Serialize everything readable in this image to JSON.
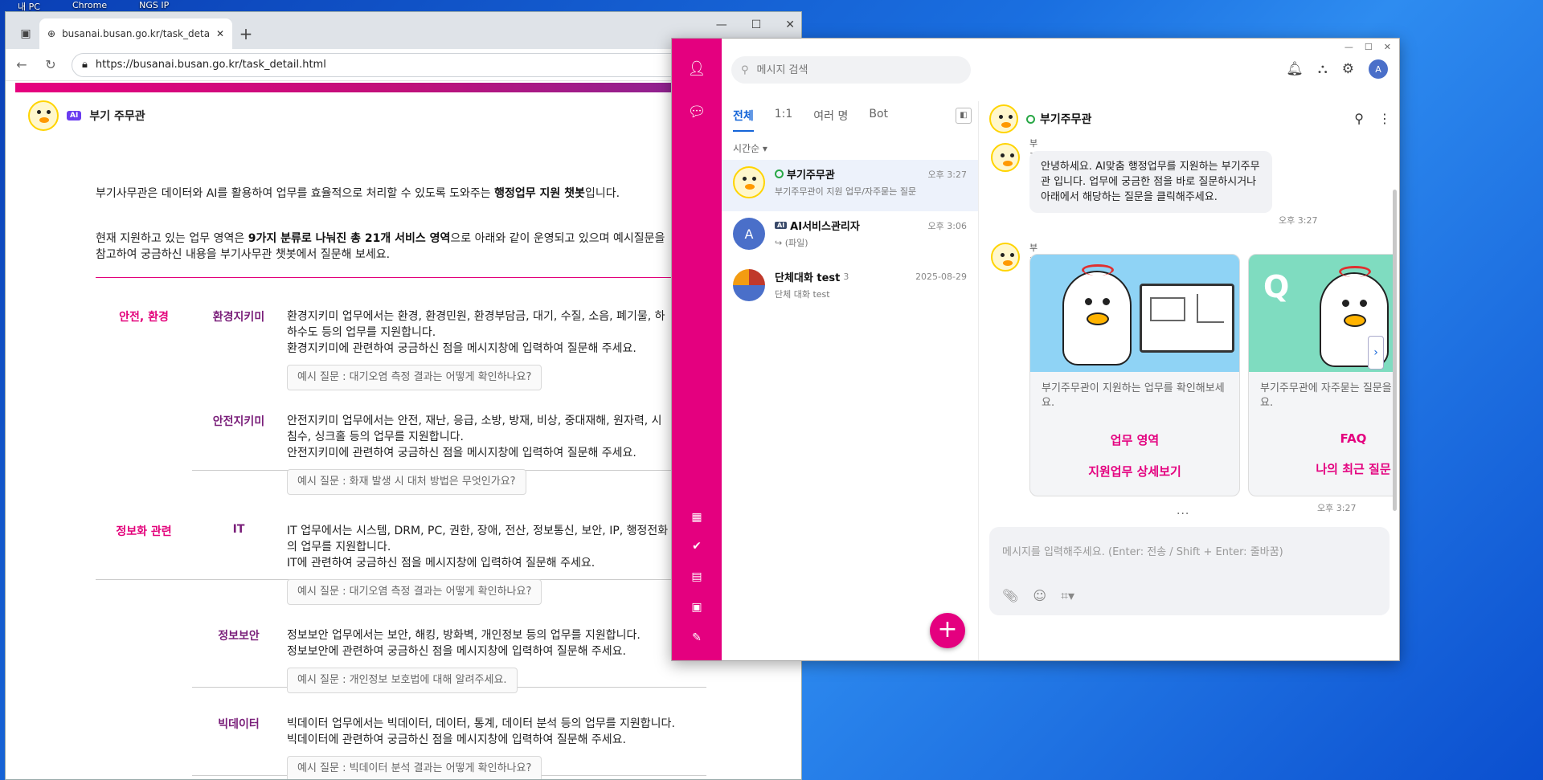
{
  "desktop": {
    "icons": [
      "내 PC",
      "Chrome",
      "NGS IP"
    ]
  },
  "browser": {
    "tab_title": "busanai.busan.go.kr/task_detail.ht",
    "url": "https://busanai.busan.go.kr/task_detail.html",
    "new_tab": "+",
    "reader_icon": "Á"
  },
  "site": {
    "ai_badge": "AI",
    "title": "부기 주무관",
    "intro1_pre": "부기사무관은 데이터와 AI를 활용하여 업무를 효율적으로 처리할 수 있도록 도와주는 ",
    "intro1_bold": "행정업무 지원 챗봇",
    "intro1_post": "입니다.",
    "intro2_pre": "현재 지원하고 있는 업무 영역은 ",
    "intro2_bold": "9가지 분류로 나눠진 총 21개 서비스 영역",
    "intro2_post": "으로 아래와 같이 운영되고 있으며 예시질문을",
    "intro2_line2": "참고하여 궁금하신 내용을 부기사무관 챗봇에서 질문해 보세요.",
    "rows": [
      {
        "category": "안전, 환경",
        "sub": "환경지키미",
        "l1": "환경지키미 업무에서는 환경, 환경민원, 환경부담금, 대기, 수질, 소음, 폐기물, 하",
        "l2": "하수도 등의 업무를 지원합니다.",
        "l3": "환경지키미에 관련하여 궁금하신 점을 메시지창에 입력하여 질문해 주세요.",
        "example": "예시 질문 : 대기오염 측정 결과는 어떻게 확인하나요?"
      },
      {
        "category": "",
        "sub": "안전지키미",
        "l1": "안전지키미 업무에서는 안전, 재난, 응급, 소방, 방재, 비상, 중대재해, 원자력, 시",
        "l2": "침수, 싱크홀 등의 업무를 지원합니다.",
        "l3": "안전지키미에 관련하여 궁금하신 점을 메시지창에 입력하여 질문해 주세요.",
        "example": "예시 질문 : 화재 발생 시 대처 방법은 무엇인가요?"
      },
      {
        "category": "정보화 관련",
        "sub": "IT",
        "l1": "IT 업무에서는 시스템, DRM, PC, 권한, 장애, 전산, 정보통신, 보안, IP, 행정전화",
        "l2": "의 업무를 지원합니다.",
        "l3": "IT에 관련하여 궁금하신 점을 메시지창에 입력하여 질문해 주세요.",
        "example": "예시 질문 : 대기오염 측정 결과는 어떻게 확인하나요?"
      },
      {
        "category": "",
        "sub": "정보보안",
        "l1": "정보보안 업무에서는 보안, 해킹, 방화벽, 개인정보 등의 업무를 지원합니다.",
        "l2": "정보보안에 관련하여 궁금하신 점을 메시지창에 입력하여 질문해 주세요.",
        "l3": "",
        "example": "예시 질문 : 개인정보 보호법에 대해 알려주세요."
      },
      {
        "category": "",
        "sub": "빅데이터",
        "l1": "빅데이터 업무에서는 빅데이터, 데이터, 통계, 데이터 분석 등의 업무를 지원합니다.",
        "l2": "빅데이터에 관련하여 궁금하신 점을 메시지창에 입력하여 질문해 주세요.",
        "l3": "",
        "example": "예시 질문 : 빅데이터 분석 결과는 어떻게 확인하나요?"
      }
    ]
  },
  "messenger": {
    "search_placeholder": "메시지 검색",
    "me_avatar": "A",
    "tabs": [
      "전체",
      "1:1",
      "여러 명",
      "Bot"
    ],
    "sort_label": "시간순 ▾",
    "chats": [
      {
        "name": "부기주무관",
        "time": "오후 3:27",
        "preview": "부기주무관이 지원 업무/자주묻는 질문"
      },
      {
        "name": "AI서비스관리자",
        "time": "오후 3:06",
        "preview": "↪ (파일)",
        "avatar": "A",
        "badge": "AI"
      },
      {
        "name": "단체대화 test",
        "count": "3",
        "time": "2025-08-29",
        "preview": "단체 대화 test"
      }
    ],
    "fab": "+",
    "room": {
      "title": "부기주무관",
      "sender_top": "부기주무관",
      "greeting": "안녕하세요. AI맞춤 행정업무를 지원하는 부기주무관 입니다. 업무에 궁금한 점을 바로 질문하시거나 아래에서 해당하는 질문을 클릭해주세요.",
      "greeting_time": "오후 3:27",
      "sender": "부기주무관",
      "cards": [
        {
          "text": "부기주무관이 지원하는 업무를 확인해보세요.",
          "link1": "업무 영역",
          "link2": "지원업무 상세보기"
        },
        {
          "text": "부기주무관에 자주묻는 질문을 확인해보세요.",
          "link1": "FAQ",
          "link2": "나의 최근 질문"
        }
      ],
      "card_q": "Q",
      "cards_time": "오후 3:27",
      "composer_placeholder": "메시지를 입력해주세요. (Enter: 전송 / Shift + Enter: 줄바꿈)"
    }
  }
}
